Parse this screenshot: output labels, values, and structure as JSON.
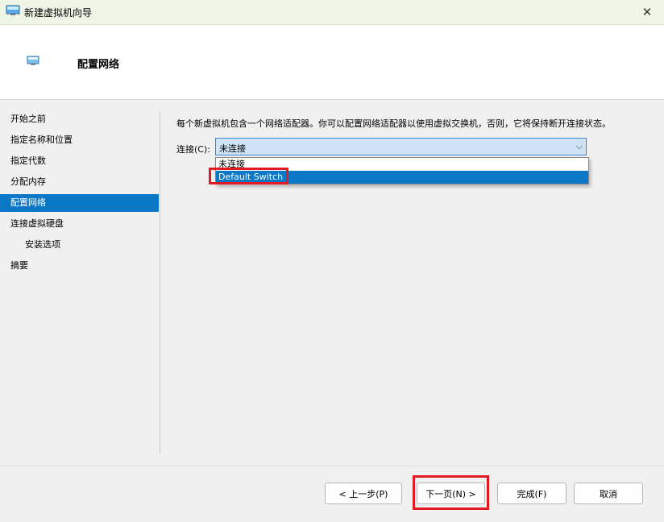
{
  "window": {
    "title": "新建虚拟机向导",
    "close_glyph": "✕",
    "icon": "monitor-icon"
  },
  "header": {
    "icon": "network-monitor-icon",
    "title": "配置网络"
  },
  "nav": {
    "items": [
      {
        "label": "开始之前"
      },
      {
        "label": "指定名称和位置"
      },
      {
        "label": "指定代数"
      },
      {
        "label": "分配内存"
      },
      {
        "label": "配置网络",
        "selected": true
      },
      {
        "label": "连接虚拟硬盘"
      },
      {
        "label": "安装选项",
        "sub": true
      },
      {
        "label": "摘要"
      }
    ]
  },
  "main": {
    "description": "每个新虚拟机包含一个网络适配器。你可以配置网络适配器以使用虚拟交换机，否则，它将保持断开连接状态。",
    "connection_label": "连接(C):",
    "combo_value": "未连接",
    "combo_arrow": "⌵",
    "options": [
      "未连接",
      "Default Switch"
    ],
    "selected_option": "Default Switch"
  },
  "buttons": {
    "prev": "< 上一步(P)",
    "next": "下一页(N) >",
    "finish": "完成(F)",
    "cancel": "取消"
  },
  "colors": {
    "selection": "#0b78c7",
    "highlight_box": "#e21a23",
    "combo_bg": "#cfe3f7"
  }
}
